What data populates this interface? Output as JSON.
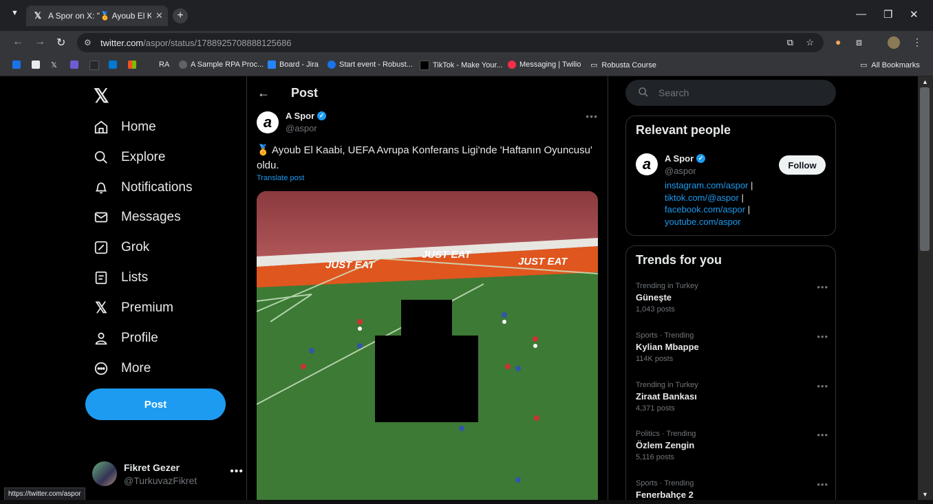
{
  "browser": {
    "tab_title": "A Spor on X: \"🏅 Ayoub El Kaabi",
    "url_host": "twitter.com",
    "url_path": "/aspor/status/1788925708888125686",
    "status_url": "https://twitter.com/aspor",
    "bookmarks": [
      {
        "label": "RA",
        "color": "#5f6368"
      },
      {
        "label": "A Sample RPA Proc...",
        "color": "#5f6368"
      },
      {
        "label": "Board - Jira",
        "color": "#2684ff"
      },
      {
        "label": "Start event - Robust...",
        "color": "#1a73e8"
      },
      {
        "label": "TikTok - Make Your...",
        "color": "#000000"
      },
      {
        "label": "Messaging | Twilio",
        "color": "#f22f46"
      },
      {
        "label": "Robusta Course",
        "color": "#e8eaed"
      }
    ],
    "all_bookmarks": "All Bookmarks"
  },
  "nav": {
    "items": [
      {
        "label": "Home",
        "icon": "home-icon"
      },
      {
        "label": "Explore",
        "icon": "search-icon"
      },
      {
        "label": "Notifications",
        "icon": "bell-icon"
      },
      {
        "label": "Messages",
        "icon": "envelope-icon"
      },
      {
        "label": "Grok",
        "icon": "grok-icon"
      },
      {
        "label": "Lists",
        "icon": "list-icon"
      },
      {
        "label": "Premium",
        "icon": "x-logo-icon"
      },
      {
        "label": "Profile",
        "icon": "person-icon"
      },
      {
        "label": "More",
        "icon": "more-circle-icon"
      }
    ],
    "post_label": "Post"
  },
  "account": {
    "name": "Fikret Gezer",
    "handle": "@TurkuvazFikret"
  },
  "main": {
    "header_title": "Post",
    "post": {
      "author_name": "A Spor",
      "author_handle": "@aspor",
      "avatar_letter": "a",
      "text": "🏅 Ayoub El Kaabi, UEFA Avrupa Konferans Ligi'nde 'Haftanın Oyuncusu' oldu.",
      "translate": "Translate post",
      "banner_text": "JUST EAT"
    }
  },
  "sidebar": {
    "search_placeholder": "Search",
    "relevant_title": "Relevant people",
    "relevant": {
      "name": "A Spor",
      "handle": "@aspor",
      "follow_label": "Follow",
      "links": [
        "instagram.com/aspor",
        "tiktok.com/@aspor",
        "facebook.com/aspor",
        "youtube.com/aspor"
      ],
      "separator": "|"
    },
    "trends_title": "Trends for you",
    "trends": [
      {
        "context": "Trending in Turkey",
        "name": "Güneşte",
        "count": "1,043 posts"
      },
      {
        "context": "Sports · Trending",
        "name": "Kylian Mbappe",
        "count": "114K posts"
      },
      {
        "context": "Trending in Turkey",
        "name": "Ziraat Bankası",
        "count": "4,371 posts"
      },
      {
        "context": "Politics · Trending",
        "name": "Özlem Zengin",
        "count": "5,116 posts"
      },
      {
        "context": "Sports · Trending",
        "name": "Fenerbahçe 2",
        "count": ""
      }
    ]
  },
  "colors": {
    "accent": "#1d9bf0",
    "background": "#000000",
    "border": "#2f3336",
    "muted_text": "#71767b"
  }
}
